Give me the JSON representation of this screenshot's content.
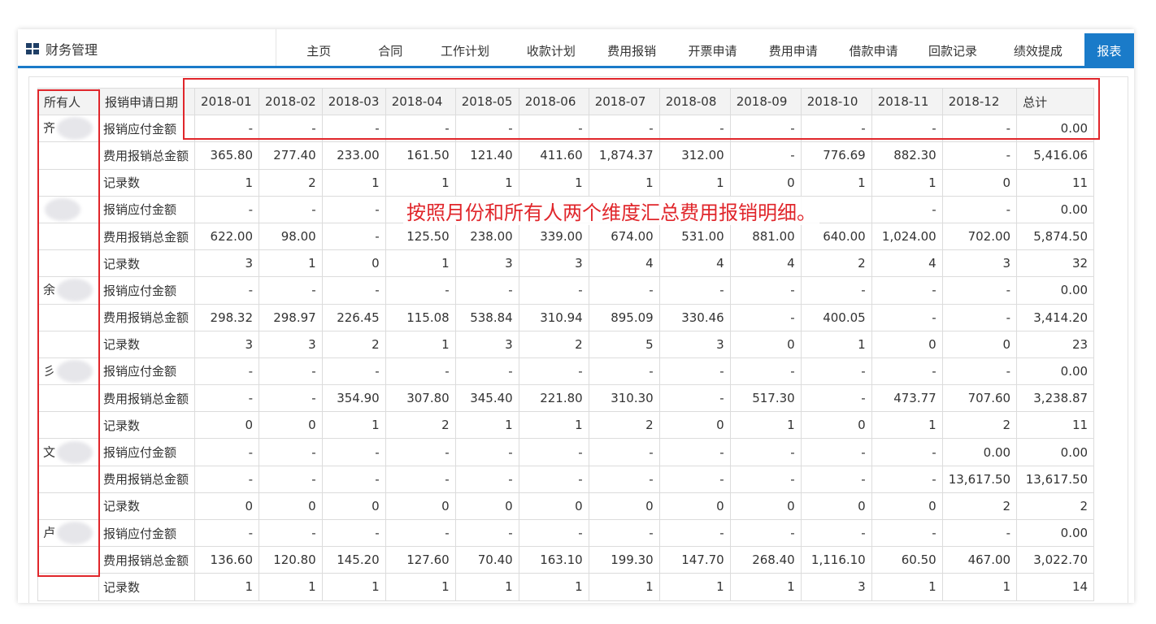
{
  "app": {
    "title": "财务管理"
  },
  "nav": {
    "tabs": [
      "主页",
      "合同",
      "工作计划",
      "收款计划",
      "费用报销",
      "开票申请",
      "费用申请",
      "借款申请",
      "回款记录",
      "绩效提成",
      "报表"
    ],
    "active_tab": "报表",
    "accent_color": "#1a7bc9"
  },
  "table": {
    "headers": [
      "所有人",
      "报销申请日期",
      "2018-01",
      "2018-02",
      "2018-03",
      "2018-04",
      "2018-05",
      "2018-06",
      "2018-07",
      "2018-08",
      "2018-09",
      "2018-10",
      "2018-11",
      "2018-12",
      "总计"
    ],
    "rows": [
      {
        "owner": "齐",
        "metric": "报销应付金额",
        "values": [
          "-",
          "-",
          "-",
          "-",
          "-",
          "-",
          "-",
          "-",
          "-",
          "-",
          "-",
          "-",
          "0.00"
        ]
      },
      {
        "owner": "",
        "metric": "费用报销总金额",
        "values": [
          "365.80",
          "277.40",
          "233.00",
          "161.50",
          "121.40",
          "411.60",
          "1,874.37",
          "312.00",
          "-",
          "776.69",
          "882.30",
          "-",
          "5,416.06"
        ]
      },
      {
        "owner": "",
        "metric": "记录数",
        "values": [
          "1",
          "2",
          "1",
          "1",
          "1",
          "1",
          "1",
          "1",
          "0",
          "1",
          "1",
          "0",
          "11"
        ]
      },
      {
        "owner": "",
        "metric": "报销应付金额",
        "values": [
          "-",
          "-",
          "-",
          "",
          "",
          "",
          "",
          "",
          "",
          "",
          "-",
          "-",
          "0.00"
        ]
      },
      {
        "owner": "",
        "metric": "费用报销总金额",
        "values": [
          "622.00",
          "98.00",
          "-",
          "125.50",
          "238.00",
          "339.00",
          "674.00",
          "531.00",
          "881.00",
          "640.00",
          "1,024.00",
          "702.00",
          "5,874.50"
        ]
      },
      {
        "owner": "",
        "metric": "记录数",
        "values": [
          "3",
          "1",
          "0",
          "1",
          "3",
          "3",
          "4",
          "4",
          "4",
          "2",
          "4",
          "3",
          "32"
        ]
      },
      {
        "owner": "余",
        "metric": "报销应付金额",
        "values": [
          "-",
          "-",
          "-",
          "-",
          "-",
          "-",
          "-",
          "-",
          "-",
          "-",
          "-",
          "-",
          "0.00"
        ]
      },
      {
        "owner": "",
        "metric": "费用报销总金额",
        "values": [
          "298.32",
          "298.97",
          "226.45",
          "115.08",
          "538.84",
          "310.94",
          "895.09",
          "330.46",
          "-",
          "400.05",
          "-",
          "-",
          "3,414.20"
        ]
      },
      {
        "owner": "",
        "metric": "记录数",
        "values": [
          "3",
          "3",
          "2",
          "1",
          "3",
          "2",
          "5",
          "3",
          "0",
          "1",
          "0",
          "0",
          "23"
        ]
      },
      {
        "owner": "彡",
        "metric": "报销应付金额",
        "values": [
          "-",
          "-",
          "-",
          "-",
          "-",
          "-",
          "-",
          "-",
          "-",
          "-",
          "-",
          "-",
          "0.00"
        ]
      },
      {
        "owner": "",
        "metric": "费用报销总金额",
        "values": [
          "-",
          "-",
          "354.90",
          "307.80",
          "345.40",
          "221.80",
          "310.30",
          "-",
          "517.30",
          "-",
          "473.77",
          "707.60",
          "3,238.87"
        ]
      },
      {
        "owner": "",
        "metric": "记录数",
        "values": [
          "0",
          "0",
          "1",
          "2",
          "1",
          "1",
          "2",
          "0",
          "1",
          "0",
          "1",
          "2",
          "11"
        ]
      },
      {
        "owner": "文",
        "metric": "报销应付金额",
        "values": [
          "-",
          "-",
          "-",
          "-",
          "-",
          "-",
          "-",
          "-",
          "-",
          "-",
          "-",
          "0.00",
          "0.00"
        ]
      },
      {
        "owner": "",
        "metric": "费用报销总金额",
        "values": [
          "-",
          "-",
          "-",
          "-",
          "-",
          "-",
          "-",
          "-",
          "-",
          "-",
          "-",
          "13,617.50",
          "13,617.50"
        ]
      },
      {
        "owner": "",
        "metric": "记录数",
        "values": [
          "0",
          "0",
          "0",
          "0",
          "0",
          "0",
          "0",
          "0",
          "0",
          "0",
          "0",
          "2",
          "2"
        ]
      },
      {
        "owner": "卢",
        "metric": "报销应付金额",
        "values": [
          "-",
          "-",
          "-",
          "-",
          "-",
          "-",
          "-",
          "-",
          "-",
          "-",
          "-",
          "-",
          "0.00"
        ]
      },
      {
        "owner": "",
        "metric": "费用报销总金额",
        "values": [
          "136.60",
          "120.80",
          "145.20",
          "127.60",
          "70.40",
          "163.10",
          "199.30",
          "147.70",
          "268.40",
          "1,116.10",
          "60.50",
          "467.00",
          "3,022.70"
        ]
      },
      {
        "owner": "",
        "metric": "记录数",
        "values": [
          "1",
          "1",
          "1",
          "1",
          "1",
          "1",
          "1",
          "1",
          "1",
          "3",
          "1",
          "1",
          "14"
        ]
      }
    ]
  },
  "annotation": {
    "text": "按照月份和所有人两个维度汇总费用报销明细。",
    "color": "#e0262b"
  }
}
